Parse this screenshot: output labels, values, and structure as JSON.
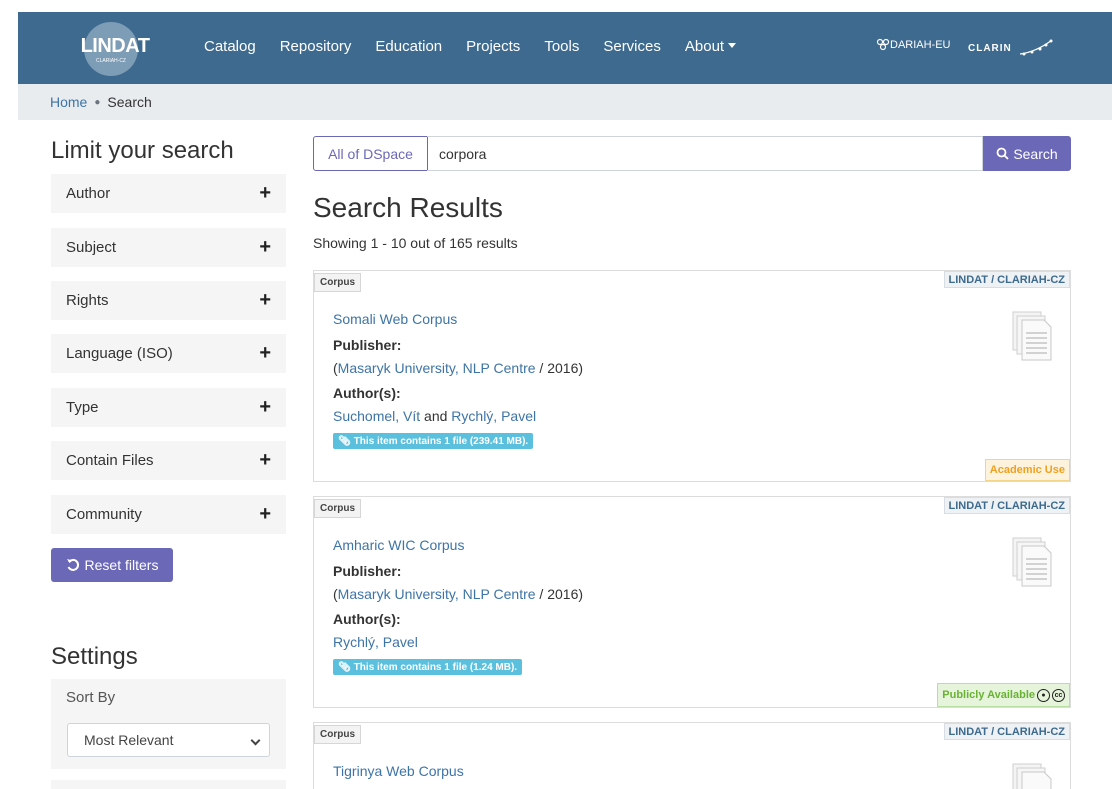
{
  "navbar": {
    "logo_text": "LINDAT",
    "logo_subtext": "CLARIAH-CZ",
    "links": [
      "Catalog",
      "Repository",
      "Education",
      "Projects",
      "Tools",
      "Services",
      "About"
    ],
    "partner1": "DARIAH-EU",
    "partner2": "CLARIN",
    "bg_color": "#3d6a8e"
  },
  "breadcrumb": {
    "home": "Home",
    "current": "Search"
  },
  "sidebar": {
    "title": "Limit your search",
    "facets": [
      "Author",
      "Subject",
      "Rights",
      "Language (ISO)",
      "Type",
      "Contain Files",
      "Community"
    ],
    "reset_label": "Reset filters",
    "settings_title": "Settings",
    "sort_label": "Sort By",
    "sort_value": "Most Relevant"
  },
  "search": {
    "scope": "All of DSpace",
    "query": "corpora",
    "button": "Search"
  },
  "results": {
    "title": "Search Results",
    "count_text": "Showing 1 - 10 out of 165 results",
    "items": [
      {
        "type": "Corpus",
        "repository": "LINDAT / CLARIAH-CZ",
        "title": "Somali Web Corpus",
        "publisher_label": "Publisher:",
        "publisher": "Masaryk University, NLP Centre",
        "year": "2016",
        "authors_label": "Author(s):",
        "author1": "Suchomel, Vít",
        "author_joiner": "and",
        "author2": "Rychlý, Pavel",
        "files": "This item contains 1 file (239.41 MB).",
        "license": "Academic Use"
      },
      {
        "type": "Corpus",
        "repository": "LINDAT / CLARIAH-CZ",
        "title": "Amharic WIC Corpus",
        "publisher_label": "Publisher:",
        "publisher": "Masaryk University, NLP Centre",
        "year": "2016",
        "authors_label": "Author(s):",
        "author1": "Rychlý, Pavel",
        "files": "This item contains 1 file (1.24 MB).",
        "license": "Publicly Available"
      },
      {
        "type": "Corpus",
        "repository": "LINDAT / CLARIAH-CZ",
        "title": "Tigrinya Web Corpus"
      }
    ]
  }
}
